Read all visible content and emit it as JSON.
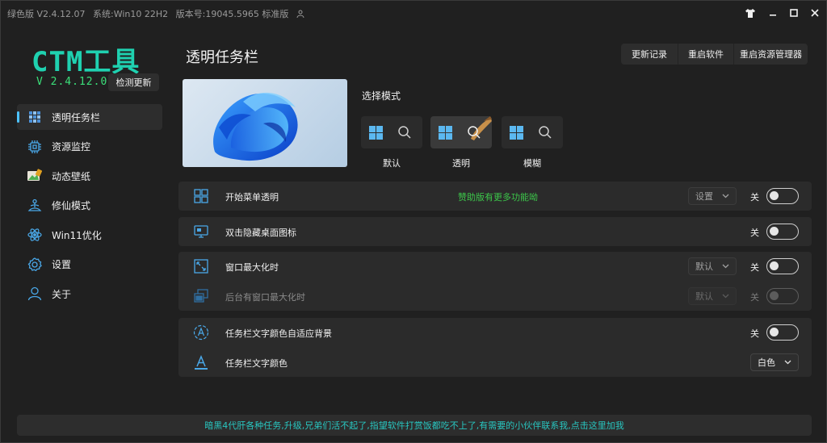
{
  "titlebar": {
    "edition": "绿色版 V2.4.12.07",
    "system": "系统:Win10 22H2",
    "build": "版本号:19045.5965 标准版"
  },
  "sidebar": {
    "logo": "CTM工具",
    "version": "V 2.4.12.07",
    "check_update": "检测更新",
    "items": [
      {
        "label": "透明任务栏",
        "icon": "taskbar-icon",
        "active": true
      },
      {
        "label": "资源监控",
        "icon": "cpu-icon"
      },
      {
        "label": "动态壁纸",
        "icon": "wallpaper-icon"
      },
      {
        "label": "修仙模式",
        "icon": "meditation-icon"
      },
      {
        "label": "Win11优化",
        "icon": "atom-icon"
      },
      {
        "label": "设置",
        "icon": "gear-icon"
      },
      {
        "label": "关于",
        "icon": "person-icon"
      }
    ]
  },
  "main": {
    "title": "透明任务栏",
    "actions": [
      "更新记录",
      "重启软件",
      "重启资源管理器"
    ],
    "mode_title": "选择模式",
    "modes": [
      {
        "label": "默认",
        "selected": false
      },
      {
        "label": "透明",
        "selected": true
      },
      {
        "label": "模糊",
        "selected": false
      }
    ],
    "settings": {
      "start_menu": {
        "label": "开始菜单透明",
        "promo": "赞助版有更多功能呦",
        "select": "设置",
        "toggle_label": "关",
        "on": false
      },
      "hide_icons": {
        "label": "双击隐藏桌面图标",
        "toggle_label": "关",
        "on": false
      },
      "maximized": {
        "label": "窗口最大化时",
        "select": "默认",
        "toggle_label": "关",
        "on": false
      },
      "background_max": {
        "label": "后台有窗口最大化时",
        "select": "默认",
        "toggle_label": "关",
        "on": false,
        "disabled": true
      },
      "adaptive_color": {
        "label": "任务栏文字颜色自适应背景",
        "toggle_label": "关",
        "on": false
      },
      "text_color": {
        "label": "任务栏文字颜色",
        "select": "白色"
      }
    }
  },
  "footer": "暗黑4代肝各种任务,升级,兄弟们活不起了,指望软件打赏饭都吃不上了,有需要的小伙伴联系我,点击这里加我",
  "colors": {
    "accent": "#4cc2ff",
    "logo": "#1fd1b0",
    "version": "#3be07a",
    "promo": "#3cc64a",
    "footer_text": "#28c6c0"
  }
}
